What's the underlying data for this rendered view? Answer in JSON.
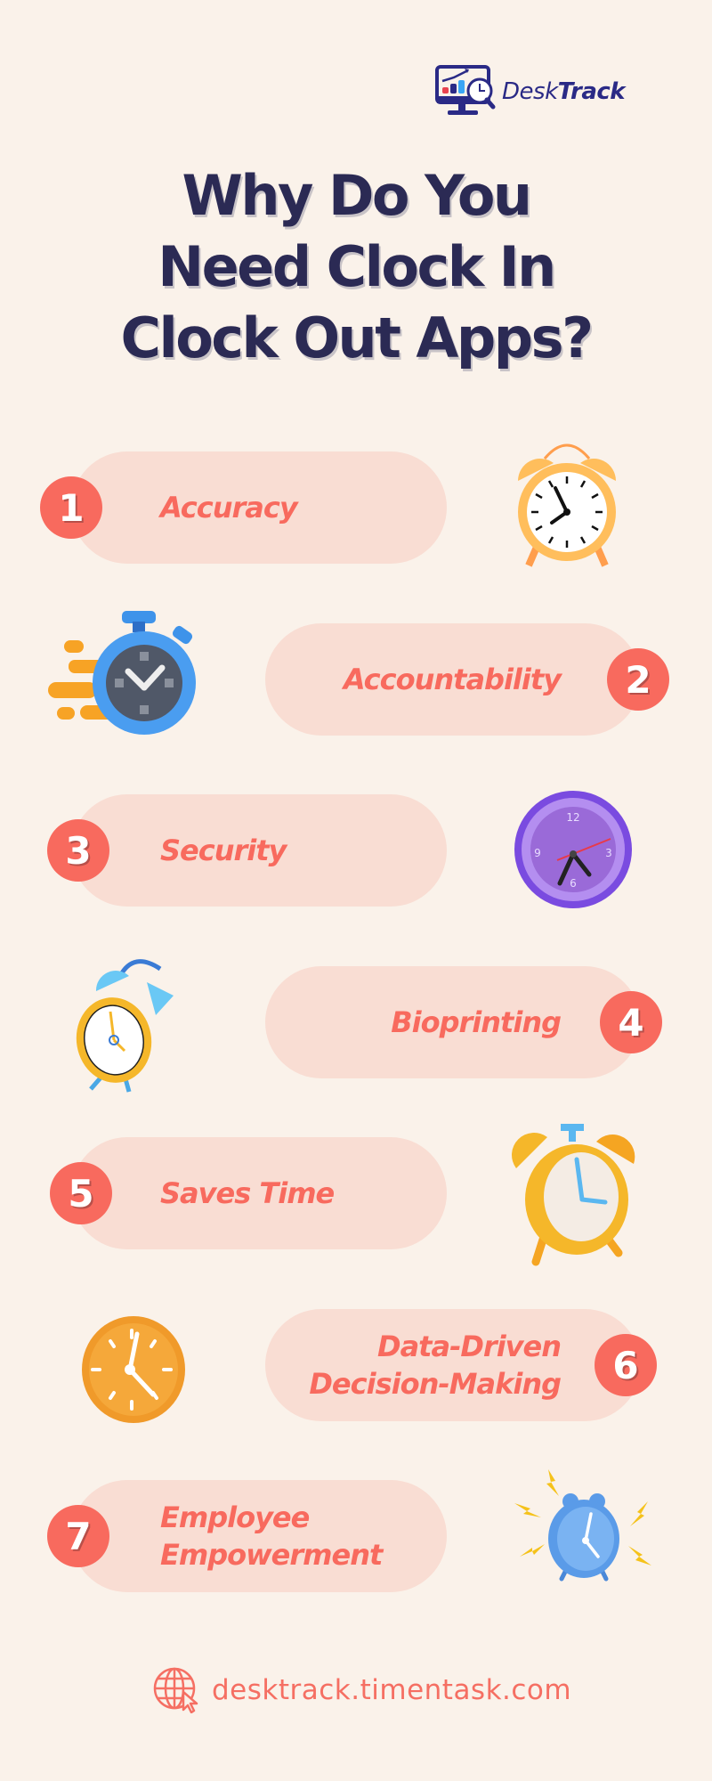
{
  "brand": {
    "name_light": "Desk",
    "name_bold": "Track",
    "logo_icon": "monitor-chart-clock-magnifier-icon"
  },
  "title": {
    "lines": [
      "Why Do You",
      "Need Clock In",
      "Clock Out Apps?"
    ]
  },
  "items": [
    {
      "number": "1",
      "label_lines": [
        "Accuracy"
      ],
      "side": "left",
      "illustration": "orange-alarm-clock-icon"
    },
    {
      "number": "2",
      "label_lines": [
        "Accountability"
      ],
      "side": "right",
      "illustration": "blue-stopwatch-icon"
    },
    {
      "number": "3",
      "label_lines": [
        "Security"
      ],
      "side": "left",
      "illustration": "purple-wall-clock-icon"
    },
    {
      "number": "4",
      "label_lines": [
        "Bioprinting"
      ],
      "side": "right",
      "illustration": "ringing-alarm-clock-icon"
    },
    {
      "number": "5",
      "label_lines": [
        "Saves Time"
      ],
      "side": "left",
      "illustration": "yellow-3d-alarm-clock-icon"
    },
    {
      "number": "6",
      "label_lines": [
        "Data-Driven",
        "Decision-Making"
      ],
      "side": "right",
      "illustration": "orange-wall-clock-icon"
    },
    {
      "number": "7",
      "label_lines": [
        "Employee",
        "Empowerment"
      ],
      "side": "left",
      "illustration": "blue-ringing-alarm-clock-icon"
    }
  ],
  "footer": {
    "url": "desktrack.timentask.com",
    "icon": "globe-cursor-icon"
  },
  "colors": {
    "background": "#faf2ea",
    "title": "#2b2a54",
    "accent": "#f86a5e",
    "pill": "#f9ddd3",
    "brand": "#2a2a86"
  }
}
